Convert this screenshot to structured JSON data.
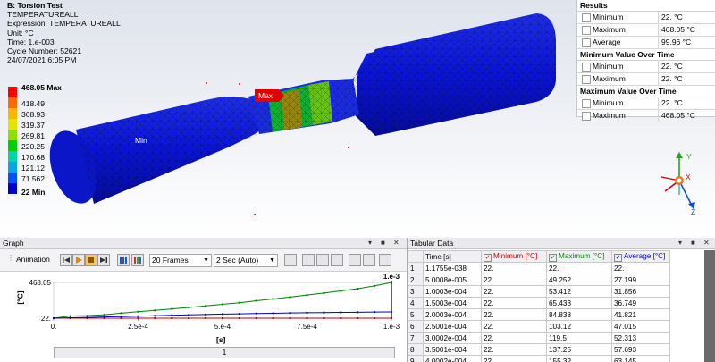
{
  "viewport": {
    "title": "B: Torsion Test",
    "lines": [
      "TEMPERATUREALL",
      "Expression: TEMPERATUREALL",
      "Unit: °C",
      "Time: 1.e-003",
      "Cycle Number: 52621",
      "24/07/2021 6:05 PM"
    ],
    "max_tag": "Max",
    "min_tag": "Min",
    "legend": [
      {
        "label": "468.05 Max",
        "color": "#ff0000",
        "bold": true
      },
      {
        "label": "418.49",
        "color": "#ff6a00",
        "bold": false
      },
      {
        "label": "368.93",
        "color": "#ffb400",
        "bold": false
      },
      {
        "label": "319.37",
        "color": "#e4e400",
        "bold": false
      },
      {
        "label": "269.81",
        "color": "#8ee000",
        "bold": false
      },
      {
        "label": "220.25",
        "color": "#00d000",
        "bold": false
      },
      {
        "label": "170.68",
        "color": "#00d4a8",
        "bold": false
      },
      {
        "label": "121.12",
        "color": "#00a8e8",
        "bold": false
      },
      {
        "label": "71.562",
        "color": "#0050ff",
        "bold": false
      },
      {
        "label": "22 Min",
        "color": "#0000d0",
        "bold": true
      }
    ],
    "triad": {
      "x": "X",
      "y": "Y",
      "z": "Z"
    }
  },
  "results": {
    "header": "Results",
    "rows": [
      {
        "key": "Minimum",
        "value": "22. °C"
      },
      {
        "key": "Maximum",
        "value": "468.05 °C"
      },
      {
        "key": "Average",
        "value": "99.96 °C"
      }
    ],
    "min_over_time_header": "Minimum Value Over Time",
    "min_over_time": [
      {
        "key": "Minimum",
        "value": "22. °C"
      },
      {
        "key": "Maximum",
        "value": "22. °C"
      }
    ],
    "max_over_time_header": "Maximum Value Over Time",
    "max_over_time": [
      {
        "key": "Minimum",
        "value": "22. °C"
      },
      {
        "key": "Maximum",
        "value": "468.05 °C"
      }
    ]
  },
  "graph": {
    "title": "Graph",
    "animation_label": "Animation",
    "frames": "20 Frames",
    "duration": "2 Sec (Auto)",
    "x_label": "[s]",
    "y_label": "[°C]",
    "top_marker": "1.e-3",
    "bottom_bar": "1"
  },
  "chart_data": {
    "type": "line",
    "x": [
      1.1755e-38,
      5.0008e-05,
      0.00010003,
      0.00015003,
      0.00020003,
      0.00025001,
      0.00030002,
      0.00035001,
      0.00040002,
      0.00045,
      0.0005,
      0.00055,
      0.0006,
      0.00065,
      0.0007,
      0.00075,
      0.0008,
      0.00085,
      0.0009,
      0.00095,
      0.001
    ],
    "series": [
      {
        "name": "Minimum [°C]",
        "color": "#c00000",
        "values": [
          22,
          22,
          22,
          22,
          22,
          22,
          22,
          22,
          22,
          22,
          22,
          22,
          22,
          22,
          22,
          22,
          22,
          22,
          22,
          22,
          22
        ]
      },
      {
        "name": "Maximum [°C]",
        "color": "#008000",
        "values": [
          22,
          49.252,
          53.412,
          65.433,
          84.838,
          103.12,
          119.5,
          137.25,
          155.32,
          175,
          195,
          215,
          240,
          262,
          285,
          310,
          335,
          362,
          390,
          425,
          468.05
        ]
      },
      {
        "name": "Average [°C]",
        "color": "#0000c0",
        "values": [
          22,
          27.199,
          31.856,
          36.749,
          41.821,
          47.015,
          52.313,
          57.693,
          63.145,
          68,
          73,
          77,
          81,
          84,
          87,
          90,
          92,
          94,
          96,
          98,
          99.96
        ]
      }
    ],
    "xlim": [
      0,
      0.001
    ],
    "ylim": [
      22,
      468.05
    ],
    "x_ticks": [
      "0.",
      "2.5e-4",
      "5.e-4",
      "7.5e-4",
      "1.e-3"
    ],
    "y_ticks": [
      "468.05",
      "22."
    ]
  },
  "tabular": {
    "title": "Tabular Data",
    "columns": [
      "Time [s]",
      "Minimum [°C]",
      "Maximum [°C]",
      "Average [°C]"
    ],
    "rows": [
      [
        "1",
        "1.1755e-038",
        "22.",
        "22.",
        "22."
      ],
      [
        "2",
        "5.0008e-005",
        "22.",
        "49.252",
        "27.199"
      ],
      [
        "3",
        "1.0003e-004",
        "22.",
        "53.412",
        "31.856"
      ],
      [
        "4",
        "1.5003e-004",
        "22.",
        "65.433",
        "36.749"
      ],
      [
        "5",
        "2.0003e-004",
        "22.",
        "84.838",
        "41.821"
      ],
      [
        "6",
        "2.5001e-004",
        "22.",
        "103.12",
        "47.015"
      ],
      [
        "7",
        "3.0002e-004",
        "22.",
        "119.5",
        "52.313"
      ],
      [
        "8",
        "3.5001e-004",
        "22.",
        "137.25",
        "57.693"
      ],
      [
        "9",
        "4.0002e-004",
        "22.",
        "155.32",
        "63.145"
      ]
    ]
  }
}
